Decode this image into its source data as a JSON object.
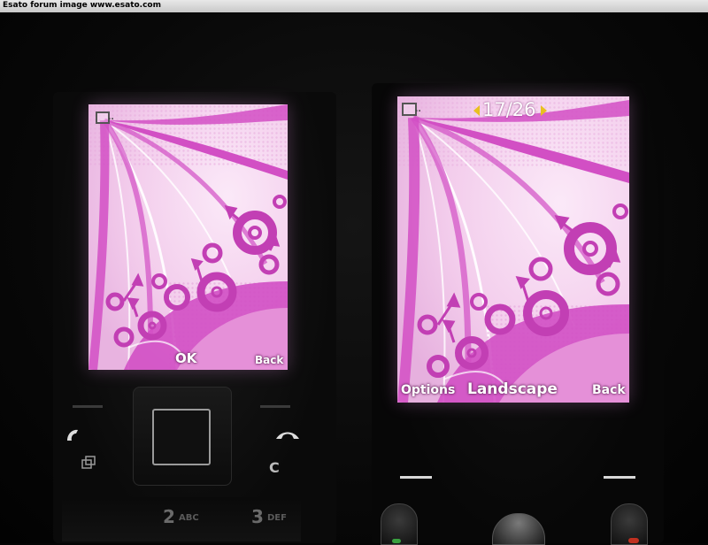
{
  "watermark": "Esato forum image www.esato.com",
  "left_phone": {
    "softkeys": {
      "center": "OK",
      "right": "Back"
    },
    "keypad": {
      "c_label": "C",
      "key2_digit": "2",
      "key2_letters": "ABC",
      "key3_digit": "3",
      "key3_letters": "DEF"
    }
  },
  "right_phone": {
    "counter": "17/26",
    "softkeys": {
      "left": "Options",
      "center": "Landscape",
      "right": "Back"
    }
  },
  "colors": {
    "pink_light": "#f6d8f2",
    "magenta": "#d24fc4",
    "deep_magenta": "#b8309f",
    "arrow_yellow": "#e8c020"
  },
  "icons": [
    "call-icon",
    "end-call-icon",
    "camera-key-icon",
    "status-icon"
  ]
}
